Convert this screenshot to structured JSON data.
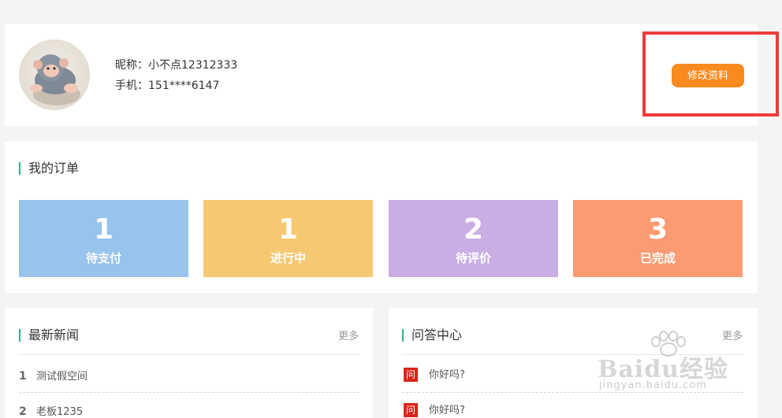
{
  "profile": {
    "nickname_label": "昵称：",
    "nickname": "小不点12312333",
    "phone_label": "手机：",
    "phone": "151****6147",
    "edit_button": "修改资料"
  },
  "orders": {
    "title": "我的订单",
    "tiles": [
      {
        "count": "1",
        "label": "待支付",
        "color": "#97c3ec"
      },
      {
        "count": "1",
        "label": "进行中",
        "color": "#f6c872"
      },
      {
        "count": "2",
        "label": "待评价",
        "color": "#c9aee5"
      },
      {
        "count": "3",
        "label": "已完成",
        "color": "#fb9b73"
      }
    ]
  },
  "news": {
    "title": "最新新闻",
    "more": "更多",
    "items": [
      {
        "index": "1",
        "text": "测试假空间"
      },
      {
        "index": "2",
        "text": "老板1235"
      }
    ]
  },
  "qa": {
    "title": "问答中心",
    "more": "更多",
    "badge": "问",
    "items": [
      {
        "text": "你好吗?"
      },
      {
        "text": "你好吗?"
      }
    ]
  },
  "watermark": {
    "brand": "Baidu经验",
    "url": "jingyan.baidu.com"
  },
  "colors": {
    "accent_orange": "#f88a1e",
    "highlight_red": "#ef3b3b",
    "title_bar_green": "#2fb380",
    "qa_badge_red": "#d9251d"
  }
}
